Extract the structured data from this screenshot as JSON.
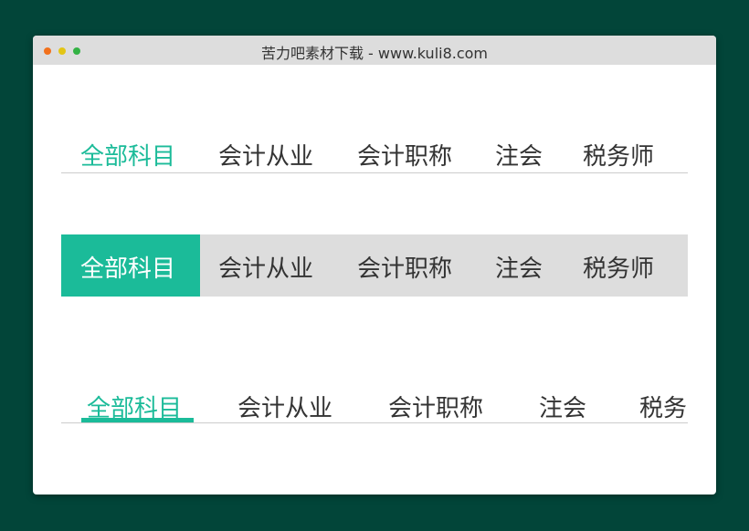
{
  "window": {
    "title": "苦力吧素材下载 - www.kuli8.com"
  },
  "colors": {
    "accent": "#1bbb99",
    "page_background": "#024539",
    "tab_bar_gray": "#dddddd"
  },
  "tabs_1": {
    "items": [
      "全部科目",
      "会计从业",
      "会计职称",
      "注会",
      "税务师"
    ],
    "active": "全部科目"
  },
  "tabs_2": {
    "items": [
      "全部科目",
      "会计从业",
      "会计职称",
      "注会",
      "税务师"
    ],
    "active": "全部科目"
  },
  "tabs_3": {
    "items": [
      "全部科目",
      "会计从业",
      "会计职称",
      "注会",
      "税务"
    ],
    "active": "全部科目"
  }
}
